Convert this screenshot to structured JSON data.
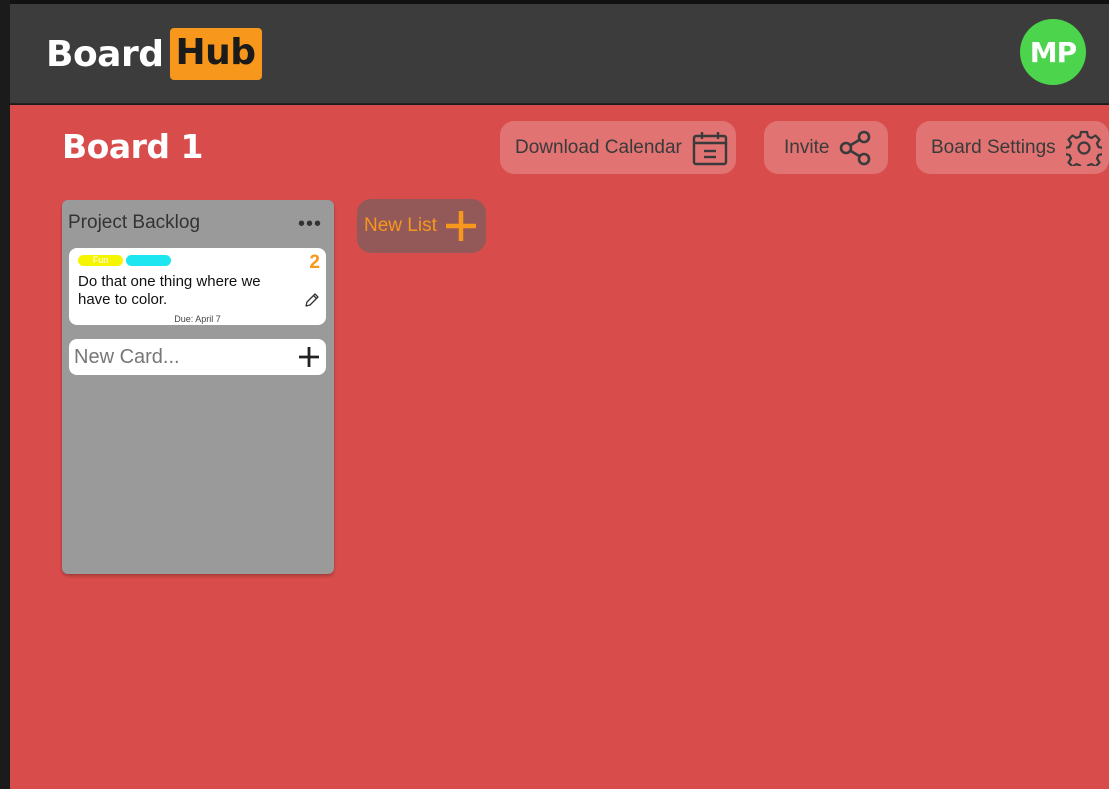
{
  "header": {
    "logo_board": "Board",
    "logo_hub": "Hub",
    "avatar_initials": "MP"
  },
  "board": {
    "title": "Board 1",
    "buttons": {
      "download_calendar": "Download Calendar",
      "invite": "Invite",
      "board_settings": "Board Settings"
    }
  },
  "lists": [
    {
      "title": "Project Backlog",
      "menu_icon": "ellipsis-icon",
      "cards": [
        {
          "tags": [
            {
              "label": "Fun",
              "color": "#f5f500"
            },
            {
              "label": "",
              "color": "#1ee6f0"
            }
          ],
          "count": "2",
          "text": "Do that one thing where we have to color.",
          "due": "Due: April 7",
          "edit_icon": "pencil-icon"
        }
      ],
      "new_card_placeholder": "New Card..."
    }
  ],
  "new_list": {
    "label": "New List",
    "icon": "plus-icon"
  },
  "colors": {
    "header_bg": "#3c3c3c",
    "board_bg": "#d94c4c",
    "accent": "#f7971b",
    "avatar_bg": "#4cd44c",
    "list_bg": "#9a9a9a"
  }
}
